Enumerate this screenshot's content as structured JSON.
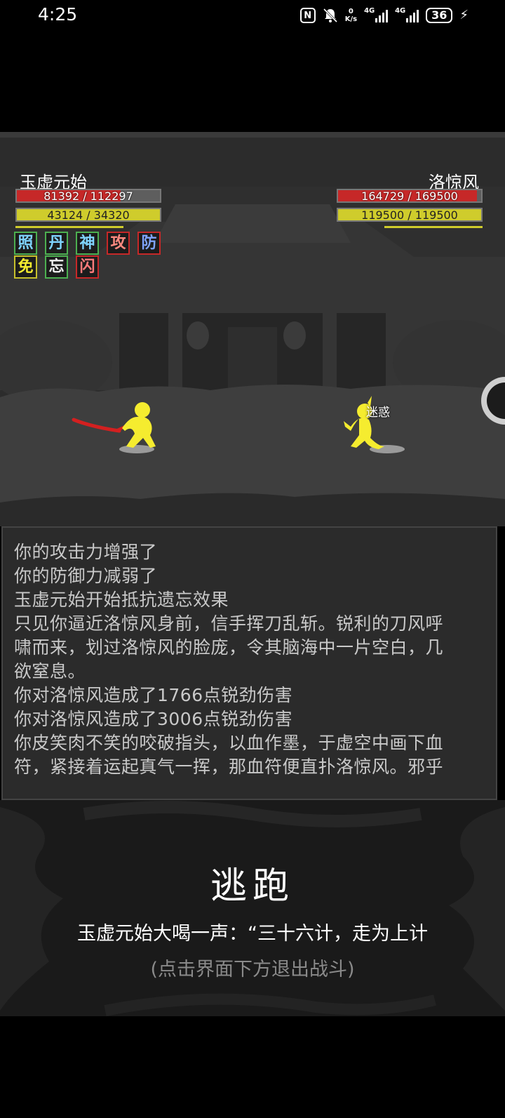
{
  "status_bar": {
    "time": "4:25",
    "speed_value": "0",
    "speed_unit": "K/s",
    "network_1": "4G",
    "network_2": "4G",
    "battery": "36",
    "icons": [
      "nfc-icon",
      "mute-bell-icon",
      "signal-icon",
      "signal-icon",
      "battery-icon",
      "charging-bolt-icon"
    ]
  },
  "player": {
    "name": "玉虚元始",
    "hp_text": "81392 / 112297",
    "hp_fraction": 0.725,
    "mp_text": "43124 / 34320",
    "mp_fraction": 1.0,
    "buffs": [
      {
        "char": "照",
        "color": "#4caf50"
      },
      {
        "char": "丹",
        "color": "#4caf50"
      },
      {
        "char": "神",
        "color": "#4caf50"
      },
      {
        "char": "攻",
        "color": "#c62828"
      },
      {
        "char": "防",
        "color": "#c62828"
      },
      {
        "char": "免",
        "color": "#c6c02c"
      },
      {
        "char": "忘",
        "color": "#4caf50"
      },
      {
        "char": "闪",
        "color": "#c62828"
      }
    ]
  },
  "enemy": {
    "name": "洛惊风",
    "hp_text": "164729 / 169500",
    "hp_fraction": 0.972,
    "mp_text": "119500 / 119500",
    "mp_fraction": 1.0,
    "status_effect": "迷惑"
  },
  "battle_log": [
    "你的攻击力增强了",
    "你的防御力减弱了",
    "玉虚元始开始抵抗遗忘效果",
    "只见你逼近洛惊风身前，信手挥刀乱斩。锐利的刀风呼",
    "啸而来，划过洛惊风的脸庞，令其脑海中一片空白，几",
    "欲窒息。",
    "你对洛惊风造成了1766点锐劲伤害",
    "你对洛惊风造成了3006点锐劲伤害",
    "你皮笑肉不笑的咬破指头，以血作墨，于虚空中画下血",
    "符，紧接着运起真气一挥，那血符便直扑洛惊风。邪乎"
  ],
  "escape": {
    "title": "逃跑",
    "message": "玉虚元始大喝一声：“三十六计，走为上计",
    "hint": "(点击界面下方退出战斗)"
  }
}
